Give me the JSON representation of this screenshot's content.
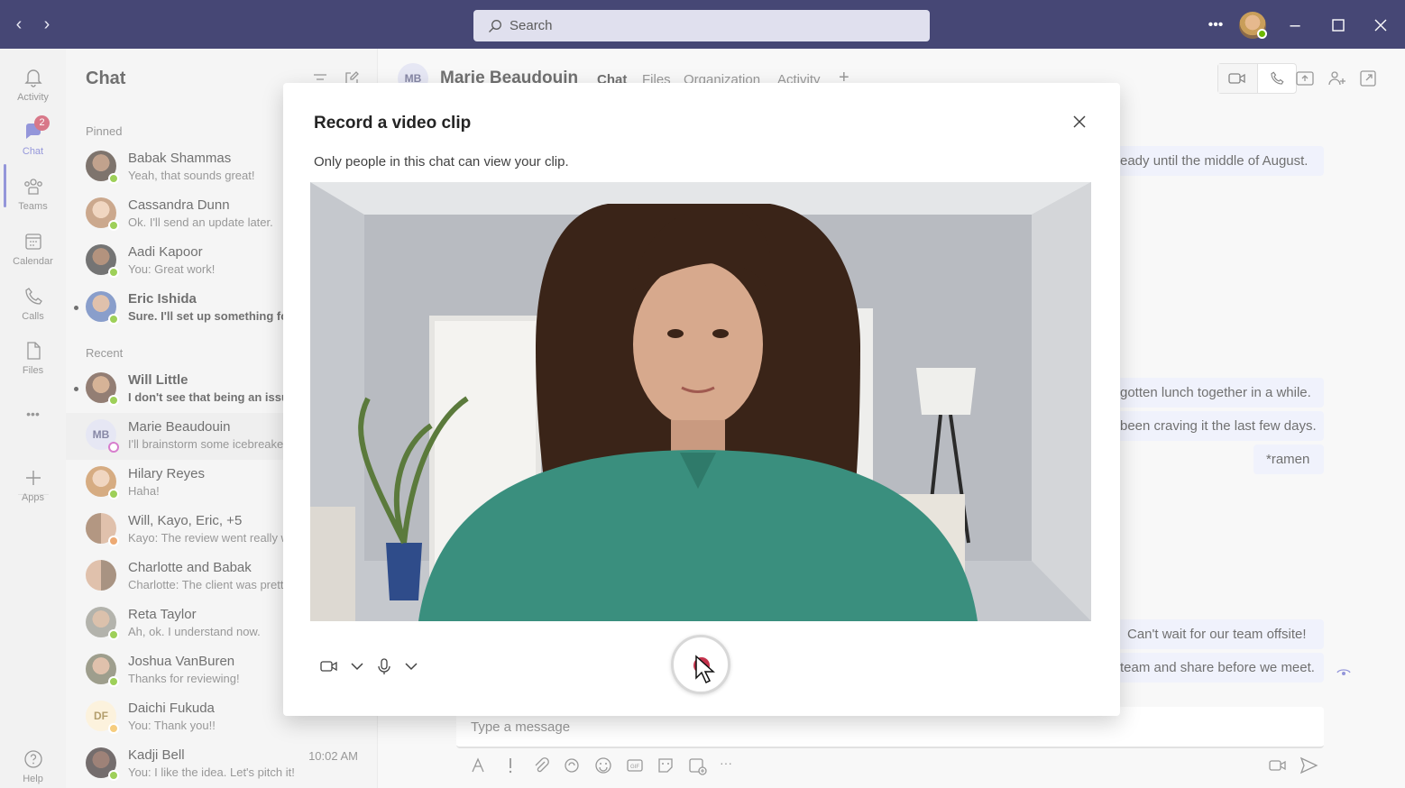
{
  "search": {
    "placeholder": "Search"
  },
  "rail": {
    "items": [
      {
        "label": "Activity",
        "icon": "bell-icon"
      },
      {
        "label": "Chat",
        "icon": "chat-icon",
        "badge": "2"
      },
      {
        "label": "Teams",
        "icon": "teams-icon"
      },
      {
        "label": "Calendar",
        "icon": "calendar-icon"
      },
      {
        "label": "Calls",
        "icon": "phone-icon"
      },
      {
        "label": "Files",
        "icon": "file-icon"
      },
      {
        "label": "Apps",
        "icon": "plus-icon"
      },
      {
        "label": "Help",
        "icon": "help-icon"
      }
    ],
    "more": "•••"
  },
  "chatlist": {
    "title": "Chat",
    "pinned_label": "Pinned",
    "recent_label": "Recent",
    "pinned": [
      {
        "name": "Babak Shammas",
        "preview": "Yeah, that sounds great!"
      },
      {
        "name": "Cassandra Dunn",
        "preview": "Ok. I'll send an update later."
      },
      {
        "name": "Aadi Kapoor",
        "preview": "You: Great work!"
      },
      {
        "name": "Eric Ishida",
        "preview": "Sure. I'll set up something for"
      }
    ],
    "recent": [
      {
        "name": "Will Little",
        "preview": "I don't see that being an issu"
      },
      {
        "name": "Marie Beaudouin",
        "preview": "I'll brainstorm some icebreake",
        "initials": "MB"
      },
      {
        "name": "Hilary Reyes",
        "preview": "Haha!"
      },
      {
        "name": "Will, Kayo, Eric, +5",
        "preview": "Kayo: The review went really w"
      },
      {
        "name": "Charlotte and Babak",
        "preview": "Charlotte: The client was prett"
      },
      {
        "name": "Reta Taylor",
        "preview": "Ah, ok. I understand now."
      },
      {
        "name": "Joshua VanBuren",
        "preview": "Thanks for reviewing!"
      },
      {
        "name": "Daichi Fukuda",
        "preview": "You: Thank you!!",
        "initials": "DF"
      },
      {
        "name": "Kadji Bell",
        "preview": "You: I like the idea. Let's pitch it!",
        "time": "10:02 AM"
      }
    ]
  },
  "header": {
    "initials": "MB",
    "name": "Marie Beaudouin",
    "tabs": [
      "Chat",
      "Files",
      "Organization",
      "Activity"
    ],
    "add_tab": "+"
  },
  "messages": [
    "eady until the middle of August.",
    "gotten lunch together in a while.",
    "been craving it the last few days.",
    "*ramen",
    "Can't wait for our team offsite!",
    "team and share before we meet."
  ],
  "composer": {
    "placeholder": "Type a message"
  },
  "modal": {
    "title": "Record a video clip",
    "subtitle": "Only people in this chat can view your clip."
  },
  "colors": {
    "titlebar": "#464775",
    "accent": "#5b5fc7",
    "record": "#c4314b",
    "presence_available": "#6bb700"
  }
}
